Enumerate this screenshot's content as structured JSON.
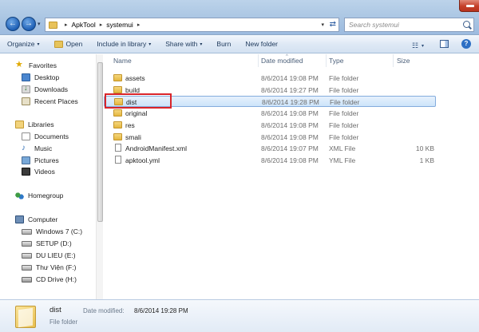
{
  "address": {
    "segments": [
      "ApkTool",
      "systemui"
    ],
    "search_placeholder": "Search systemui"
  },
  "commands": {
    "organize": "Organize",
    "open": "Open",
    "include_in_library": "Include in library",
    "share_with": "Share with",
    "burn": "Burn",
    "new_folder": "New folder"
  },
  "nav": {
    "favorites": "Favorites",
    "desktop": "Desktop",
    "downloads": "Downloads",
    "recent_places": "Recent Places",
    "libraries": "Libraries",
    "documents": "Documents",
    "music": "Music",
    "pictures": "Pictures",
    "videos": "Videos",
    "homegroup": "Homegroup",
    "computer": "Computer",
    "drives": [
      "Windows 7 (C:)",
      "SETUP (D:)",
      "DU LIEU (E:)",
      "Thư Viện (F:)",
      "CD Drive (H:)"
    ]
  },
  "columns": {
    "name": "Name",
    "date_modified": "Date modified",
    "type": "Type",
    "size": "Size"
  },
  "files": [
    {
      "name": "assets",
      "date": "8/6/2014 19:08 PM",
      "type": "File folder",
      "size": "",
      "kind": "folder"
    },
    {
      "name": "build",
      "date": "8/6/2014 19:27 PM",
      "type": "File folder",
      "size": "",
      "kind": "folder"
    },
    {
      "name": "dist",
      "date": "8/6/2014 19:28 PM",
      "type": "File folder",
      "size": "",
      "kind": "folder",
      "selected": true
    },
    {
      "name": "original",
      "date": "8/6/2014 19:08 PM",
      "type": "File folder",
      "size": "",
      "kind": "folder"
    },
    {
      "name": "res",
      "date": "8/6/2014 19:08 PM",
      "type": "File folder",
      "size": "",
      "kind": "folder"
    },
    {
      "name": "smali",
      "date": "8/6/2014 19:08 PM",
      "type": "File folder",
      "size": "",
      "kind": "folder"
    },
    {
      "name": "AndroidManifest.xml",
      "date": "8/6/2014 19:07 PM",
      "type": "XML File",
      "size": "10 KB",
      "kind": "file"
    },
    {
      "name": "apktool.yml",
      "date": "8/6/2014 19:08 PM",
      "type": "YML File",
      "size": "1 KB",
      "kind": "file"
    }
  ],
  "details": {
    "name": "dist",
    "date_label": "Date modified:",
    "date": "8/6/2014 19:28 PM",
    "type": "File folder"
  },
  "colors": {
    "selection_highlight": "#d9252a",
    "selection_fill": "#cde4fa"
  }
}
